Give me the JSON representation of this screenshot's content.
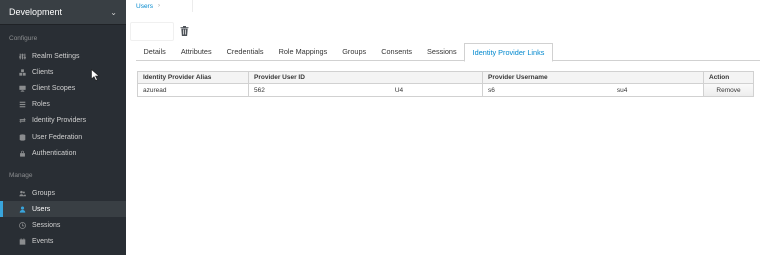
{
  "sidebar": {
    "realm": "Development",
    "configure_label": "Configure",
    "manage_label": "Manage",
    "configure_items": [
      {
        "label": "Realm Settings",
        "icon": "sliders-icon"
      },
      {
        "label": "Clients",
        "icon": "cubes-icon"
      },
      {
        "label": "Client Scopes",
        "icon": "desktop-icon"
      },
      {
        "label": "Roles",
        "icon": "list-icon"
      },
      {
        "label": "Identity Providers",
        "icon": "exchange-icon"
      },
      {
        "label": "User Federation",
        "icon": "database-icon"
      },
      {
        "label": "Authentication",
        "icon": "lock-icon"
      }
    ],
    "manage_items": [
      {
        "label": "Groups",
        "icon": "users-icon"
      },
      {
        "label": "Users",
        "icon": "user-icon",
        "active": true
      },
      {
        "label": "Sessions",
        "icon": "clock-icon"
      },
      {
        "label": "Events",
        "icon": "calendar-icon"
      }
    ]
  },
  "breadcrumb": {
    "item": "Users",
    "separator": "›"
  },
  "tabs": [
    "Details",
    "Attributes",
    "Credentials",
    "Role Mappings",
    "Groups",
    "Consents",
    "Sessions",
    "Identity Provider Links"
  ],
  "active_tab": "Identity Provider Links",
  "table": {
    "headers": [
      "Identity Provider Alias",
      "Provider User ID",
      "Provider Username",
      "Action"
    ],
    "rows": [
      {
        "alias": "azuread",
        "user_id_start": "562",
        "user_id_end": "U4",
        "username_start": "s6",
        "username_end": "su4",
        "action": "Remove"
      }
    ]
  },
  "colors": {
    "sidebar_bg": "#292e34",
    "accent": "#0088ce",
    "active_indicator": "#39a5dc"
  }
}
